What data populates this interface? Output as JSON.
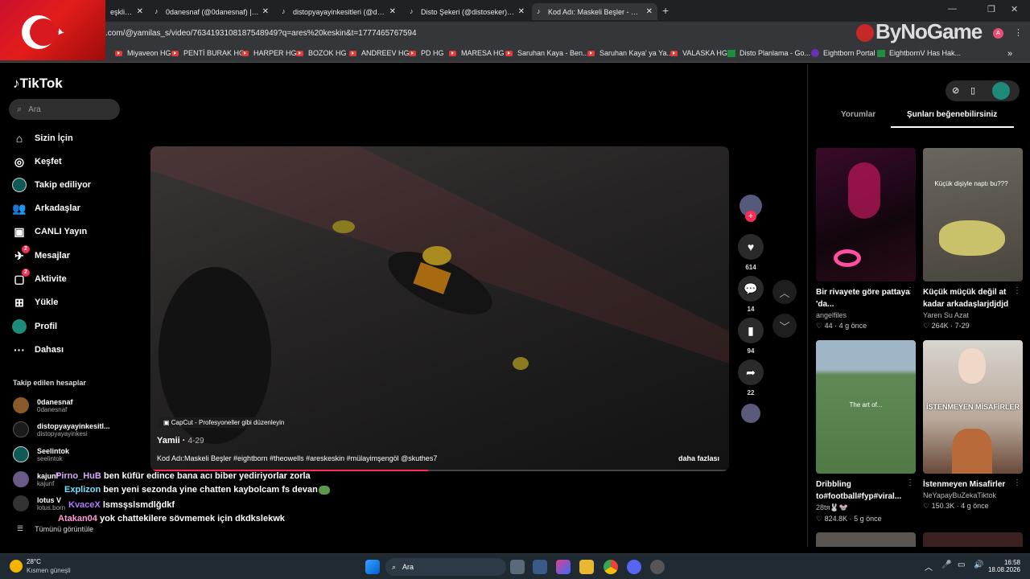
{
  "browser": {
    "tabs": [
      {
        "title": "eşkli flö",
        "active": false
      },
      {
        "title": "0danesnaf (@0danesnaf) | TikTok",
        "active": false
      },
      {
        "title": "distopyayayinkesitleri (@distop",
        "active": false
      },
      {
        "title": "Disto Şekeri (@distoseker) | Tik",
        "active": false
      },
      {
        "title": "Kod Adı: Maskeli Beşler - Eighth",
        "active": true
      }
    ],
    "url": ".com/@yamilas_s/video/7634193108187548949?q=ares%20keskin&t=1777465767594",
    "bookmarks": [
      "Miyaveon HG",
      "PENTİ BURAK HG",
      "HARPER HG",
      "BOZOK HG",
      "ANDREEV HG",
      "PD HG",
      "MARESA HG",
      "Saruhan Kaya - Ben...",
      "Saruhan Kaya' ya Ya...",
      "VALASKA HG",
      "Disto Planlama - Go...",
      "Eightborn Portal",
      "EightbornV Has Hak..."
    ]
  },
  "overlay_logo": "ByNoGame",
  "tiktok": {
    "logo": "TikTok",
    "search_placeholder": "Ara",
    "nav": [
      {
        "label": "Sizin İçin",
        "icon": "home-icon",
        "badge": ""
      },
      {
        "label": "Keşfet",
        "icon": "compass-icon",
        "badge": ""
      },
      {
        "label": "Takip ediliyor",
        "icon": "following-avatar-icon",
        "badge": ""
      },
      {
        "label": "Arkadaşlar",
        "icon": "friends-icon",
        "badge": ""
      },
      {
        "label": "CANLI Yayın",
        "icon": "live-icon",
        "badge": ""
      },
      {
        "label": "Mesajlar",
        "icon": "messages-icon",
        "badge": "2"
      },
      {
        "label": "Aktivite",
        "icon": "activity-icon",
        "badge": "2"
      },
      {
        "label": "Yükle",
        "icon": "upload-icon",
        "badge": ""
      },
      {
        "label": "Profil",
        "icon": "profile-icon",
        "badge": ""
      },
      {
        "label": "Dahası",
        "icon": "more-icon",
        "badge": ""
      }
    ],
    "following_title": "Takip edilen hesaplar",
    "following": [
      {
        "name": "0danesnaf",
        "user": "0danesnaf"
      },
      {
        "name": "distopyayayinkesitl...",
        "user": "distopyayayinkesi"
      },
      {
        "name": "Seelintok",
        "user": "seelintok"
      },
      {
        "name": "kajunf",
        "user": "kajunf"
      },
      {
        "name": "lotus V",
        "user": "lotus.born"
      }
    ],
    "see_all": "Tümünü görüntüle"
  },
  "video": {
    "capcut": "CapCut - Profesyoneller gibi düzenleyin",
    "author": "Yamii",
    "date": "4-29",
    "description": "Kod Adı:Maskeli Beşler #eightborn #theowells #areskeskin #mülayimşengöl @skuthes7",
    "more": "daha fazlası",
    "progress": 0.48,
    "likes": "614",
    "comments": "14",
    "saves": "94",
    "shares": "22"
  },
  "chat": [
    {
      "user": "Pirno_HuB",
      "msg": "ben küfür edince bana acı biber yediriyorlar zorla",
      "color": "#d6a8ff"
    },
    {
      "user": "Explizon",
      "msg": "ben yeni sezonda yine chatten kaybolcam fs devan",
      "color": "#6fe3ff"
    },
    {
      "user": "KvaceX",
      "msg": "lsmsşslsmdlğdkf",
      "color": "#b47bff"
    },
    {
      "user": "Atakan04",
      "msg": "yok chattekilere sövmemek için dkdkslekwk",
      "color": "#ff9ad5"
    }
  ],
  "right_panel": {
    "tabs": [
      "Yorumlar",
      "Şunları beğenebilirsiniz"
    ],
    "cards": [
      {
        "title": "Bir rivayete göre pattaya 'da...",
        "author": "angelfiles",
        "likes": "44",
        "age": "4 g önce",
        "overlay": ""
      },
      {
        "title": "Küçük müçük değil at kadar arkadaşlarjdjdjd",
        "author": "Yaren Su Azat",
        "likes": "264K",
        "age": "7-29",
        "overlay": "Küçük dişiyle naptı bu???"
      },
      {
        "title": "Dribbling to#football#fyp#viral...",
        "author": "28tя🐰🐭",
        "likes": "824.8K",
        "age": "5 g önce",
        "overlay": "The art of..."
      },
      {
        "title": "İstenmeyen Misafirler",
        "author": "NeYapayBuZekaTiktok",
        "likes": "150.3K",
        "age": "4 g önce",
        "overlay": "İSTENMEYEN MİSAFİRLER"
      }
    ]
  },
  "taskbar": {
    "weather_temp": "28°C",
    "weather_desc": "Kısmen güneşli",
    "search": "Ara",
    "time": "16:58",
    "date": "18.08.2026"
  }
}
